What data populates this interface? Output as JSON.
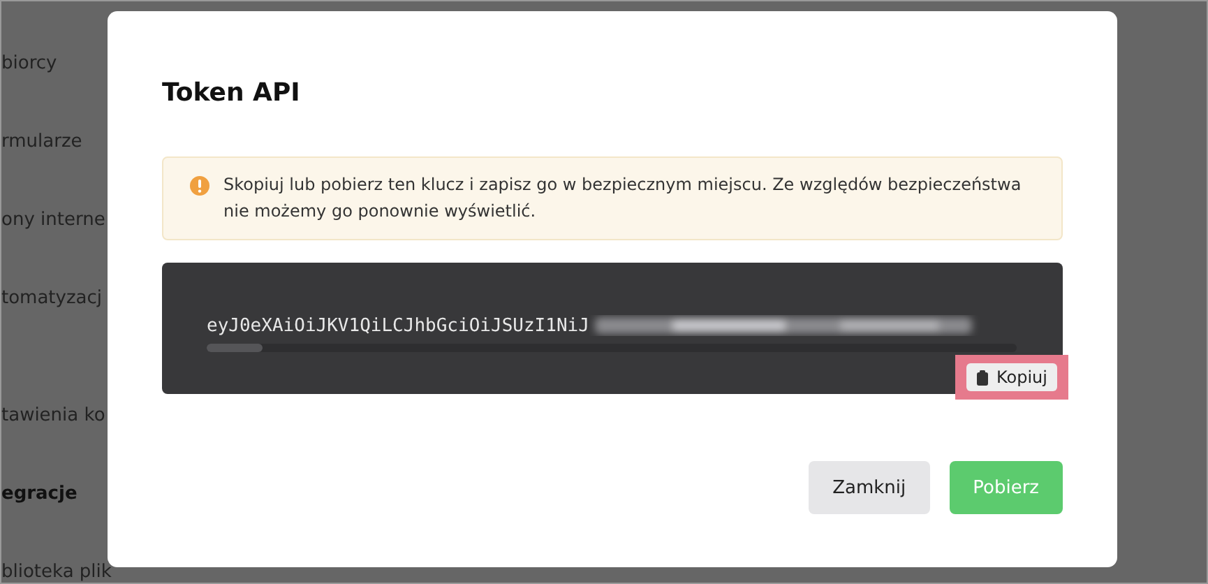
{
  "sidebar": {
    "items": [
      {
        "label": "biorcy",
        "selected": false
      },
      {
        "label": "rmularze",
        "selected": false
      },
      {
        "label": "ony interne",
        "selected": false
      },
      {
        "label": "tomatyzacj",
        "selected": false
      },
      {
        "label": "tawienia ko",
        "selected": false
      },
      {
        "label": "egracje",
        "selected": true
      },
      {
        "label": "blioteka plik",
        "selected": false
      }
    ]
  },
  "modal": {
    "title": "Token API",
    "alert": {
      "text": "Skopiuj lub pobierz ten klucz i zapisz go w bezpiecznym miejscu. Ze względów bezpieczeństwa nie możemy go ponownie wyświetlić."
    },
    "token": {
      "visible_text": "eyJ0eXAiOiJKV1QiLCJhbGciOiJSUzI1NiJ",
      "copy_button": "Kopiuj",
      "highlighted": true
    },
    "buttons": [
      {
        "label": "Zamknij",
        "kind": "secondary"
      },
      {
        "label": "Pobierz",
        "kind": "primary"
      }
    ]
  }
}
